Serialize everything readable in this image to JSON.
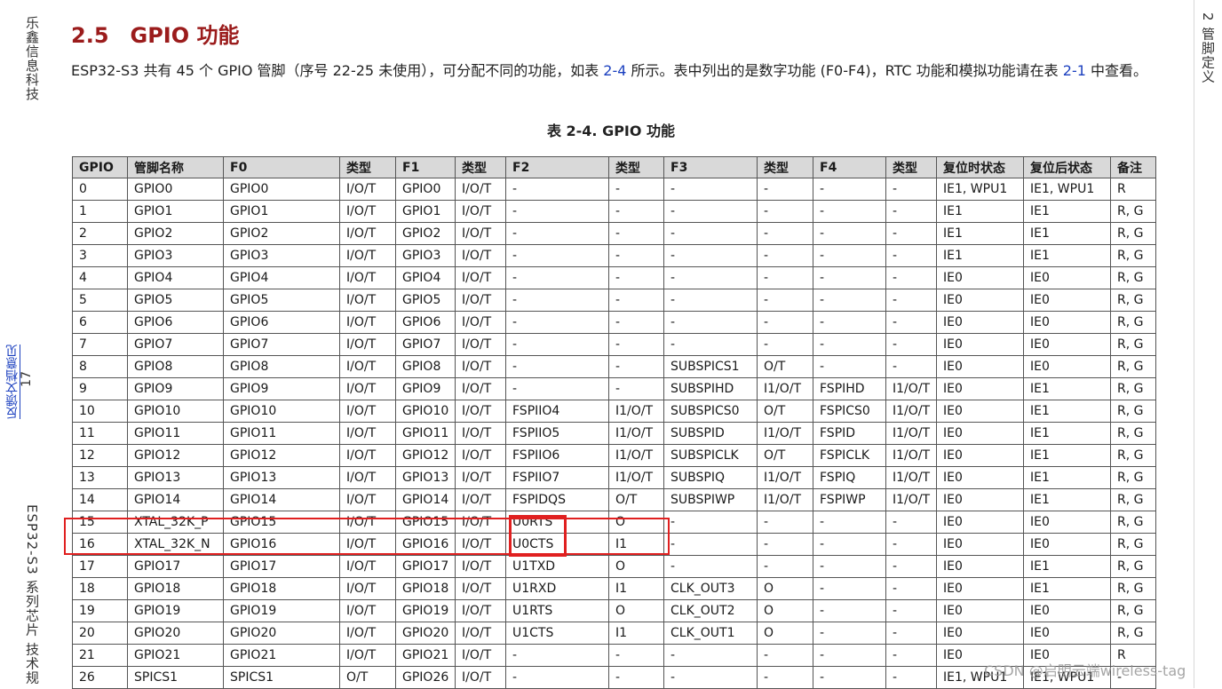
{
  "side": {
    "company": "乐鑫信息科技",
    "page_number": "17",
    "feedback_link": "反馈文档意见",
    "doc_title": "ESP32-S3 系列芯片 技术规",
    "chapter": "2 管脚定义"
  },
  "section": {
    "number": "2.5",
    "title": "GPIO 功能",
    "para_1": "ESP32-S3 共有 45 个 GPIO 管脚（序号 22-25 未使用），可分配不同的功能，如表 ",
    "para_ref_1": "2-4",
    "para_2": " 所示。表中列出的是数字功能 (F0-F4)，RTC 功能和模拟功能请在表 ",
    "para_ref_2": "2-1",
    "para_3": " 中查看。"
  },
  "table": {
    "caption": "表 2-4. GPIO 功能",
    "headers": [
      "GPIO",
      "管脚名称",
      "F0",
      "类型",
      "F1",
      "类型",
      "F2",
      "类型",
      "F3",
      "类型",
      "F4",
      "类型",
      "复位时状态",
      "复位后状态",
      "备注"
    ],
    "rows": [
      [
        "0",
        "GPIO0",
        "GPIO0",
        "I/O/T",
        "GPIO0",
        "I/O/T",
        "-",
        "-",
        "-",
        "-",
        "-",
        "-",
        "IE1, WPU1",
        "IE1, WPU1",
        "R"
      ],
      [
        "1",
        "GPIO1",
        "GPIO1",
        "I/O/T",
        "GPIO1",
        "I/O/T",
        "-",
        "-",
        "-",
        "-",
        "-",
        "-",
        "IE1",
        "IE1",
        "R, G"
      ],
      [
        "2",
        "GPIO2",
        "GPIO2",
        "I/O/T",
        "GPIO2",
        "I/O/T",
        "-",
        "-",
        "-",
        "-",
        "-",
        "-",
        "IE1",
        "IE1",
        "R, G"
      ],
      [
        "3",
        "GPIO3",
        "GPIO3",
        "I/O/T",
        "GPIO3",
        "I/O/T",
        "-",
        "-",
        "-",
        "-",
        "-",
        "-",
        "IE1",
        "IE1",
        "R, G"
      ],
      [
        "4",
        "GPIO4",
        "GPIO4",
        "I/O/T",
        "GPIO4",
        "I/O/T",
        "-",
        "-",
        "-",
        "-",
        "-",
        "-",
        "IE0",
        "IE0",
        "R, G"
      ],
      [
        "5",
        "GPIO5",
        "GPIO5",
        "I/O/T",
        "GPIO5",
        "I/O/T",
        "-",
        "-",
        "-",
        "-",
        "-",
        "-",
        "IE0",
        "IE0",
        "R, G"
      ],
      [
        "6",
        "GPIO6",
        "GPIO6",
        "I/O/T",
        "GPIO6",
        "I/O/T",
        "-",
        "-",
        "-",
        "-",
        "-",
        "-",
        "IE0",
        "IE0",
        "R, G"
      ],
      [
        "7",
        "GPIO7",
        "GPIO7",
        "I/O/T",
        "GPIO7",
        "I/O/T",
        "-",
        "-",
        "-",
        "-",
        "-",
        "-",
        "IE0",
        "IE0",
        "R, G"
      ],
      [
        "8",
        "GPIO8",
        "GPIO8",
        "I/O/T",
        "GPIO8",
        "I/O/T",
        "-",
        "-",
        "SUBSPICS1",
        "O/T",
        "-",
        "-",
        "IE0",
        "IE0",
        "R, G"
      ],
      [
        "9",
        "GPIO9",
        "GPIO9",
        "I/O/T",
        "GPIO9",
        "I/O/T",
        "-",
        "-",
        "SUBSPIHD",
        "I1/O/T",
        "FSPIHD",
        "I1/O/T",
        "IE0",
        "IE1",
        "R, G"
      ],
      [
        "10",
        "GPIO10",
        "GPIO10",
        "I/O/T",
        "GPIO10",
        "I/O/T",
        "FSPIIO4",
        "I1/O/T",
        "SUBSPICS0",
        "O/T",
        "FSPICS0",
        "I1/O/T",
        "IE0",
        "IE1",
        "R, G"
      ],
      [
        "11",
        "GPIO11",
        "GPIO11",
        "I/O/T",
        "GPIO11",
        "I/O/T",
        "FSPIIO5",
        "I1/O/T",
        "SUBSPID",
        "I1/O/T",
        "FSPID",
        "I1/O/T",
        "IE0",
        "IE1",
        "R, G"
      ],
      [
        "12",
        "GPIO12",
        "GPIO12",
        "I/O/T",
        "GPIO12",
        "I/O/T",
        "FSPIIO6",
        "I1/O/T",
        "SUBSPICLK",
        "O/T",
        "FSPICLK",
        "I1/O/T",
        "IE0",
        "IE1",
        "R, G"
      ],
      [
        "13",
        "GPIO13",
        "GPIO13",
        "I/O/T",
        "GPIO13",
        "I/O/T",
        "FSPIIO7",
        "I1/O/T",
        "SUBSPIQ",
        "I1/O/T",
        "FSPIQ",
        "I1/O/T",
        "IE0",
        "IE1",
        "R, G"
      ],
      [
        "14",
        "GPIO14",
        "GPIO14",
        "I/O/T",
        "GPIO14",
        "I/O/T",
        "FSPIDQS",
        "O/T",
        "SUBSPIWP",
        "I1/O/T",
        "FSPIWP",
        "I1/O/T",
        "IE0",
        "IE1",
        "R, G"
      ],
      [
        "15",
        "XTAL_32K_P",
        "GPIO15",
        "I/O/T",
        "GPIO15",
        "I/O/T",
        "U0RTS",
        "O",
        "-",
        "-",
        "-",
        "-",
        "IE0",
        "IE0",
        "R, G"
      ],
      [
        "16",
        "XTAL_32K_N",
        "GPIO16",
        "I/O/T",
        "GPIO16",
        "I/O/T",
        "U0CTS",
        "I1",
        "-",
        "-",
        "-",
        "-",
        "IE0",
        "IE0",
        "R, G"
      ],
      [
        "17",
        "GPIO17",
        "GPIO17",
        "I/O/T",
        "GPIO17",
        "I/O/T",
        "U1TXD",
        "O",
        "-",
        "-",
        "-",
        "-",
        "IE0",
        "IE1",
        "R, G"
      ],
      [
        "18",
        "GPIO18",
        "GPIO18",
        "I/O/T",
        "GPIO18",
        "I/O/T",
        "U1RXD",
        "I1",
        "CLK_OUT3",
        "O",
        "-",
        "-",
        "IE0",
        "IE1",
        "R, G"
      ],
      [
        "19",
        "GPIO19",
        "GPIO19",
        "I/O/T",
        "GPIO19",
        "I/O/T",
        "U1RTS",
        "O",
        "CLK_OUT2",
        "O",
        "-",
        "-",
        "IE0",
        "IE0",
        "R, G"
      ],
      [
        "20",
        "GPIO20",
        "GPIO20",
        "I/O/T",
        "GPIO20",
        "I/O/T",
        "U1CTS",
        "I1",
        "CLK_OUT1",
        "O",
        "-",
        "-",
        "IE0",
        "IE0",
        "R, G"
      ],
      [
        "21",
        "GPIO21",
        "GPIO21",
        "I/O/T",
        "GPIO21",
        "I/O/T",
        "-",
        "-",
        "-",
        "-",
        "-",
        "-",
        "IE0",
        "IE0",
        "R"
      ],
      [
        "26",
        "SPICS1",
        "SPICS1",
        "O/T",
        "GPIO26",
        "I/O/T",
        "-",
        "-",
        "-",
        "-",
        "-",
        "-",
        "IE1, WPU1",
        "IE1, WPU1",
        "-"
      ]
    ]
  },
  "watermark": "CSDN @启明云端wireless-tag",
  "colors": {
    "heading": "#9b1c1c",
    "link": "#1a3fbf",
    "highlight": "#e02020",
    "header_bg": "#d9d9d9"
  }
}
